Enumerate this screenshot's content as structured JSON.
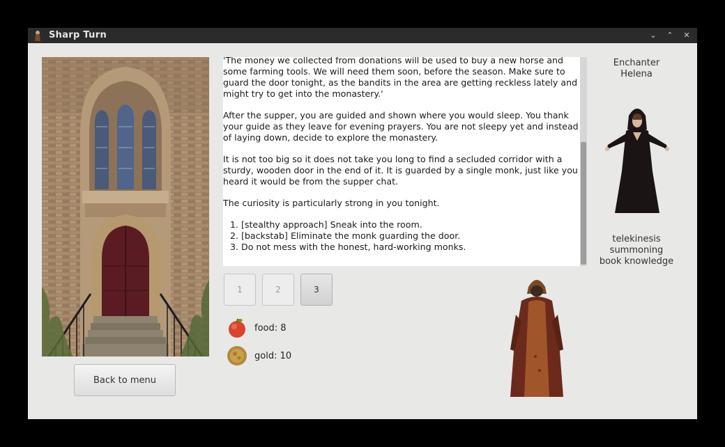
{
  "window": {
    "title": "Sharp Turn"
  },
  "story": {
    "paragraphs": [
      "'The money we collected from donations will be used to buy a new horse and some farming tools. We will need them soon, before the season. Make sure to guard the door tonight, as the bandits in the area are getting reckless lately and might try to get into the monastery.'",
      "After the supper, you are guided and shown where you would sleep. You thank your guide as they leave for evening prayers. You are not sleepy yet and instead of laying down, decide to explore the monastery.",
      "It is not too big so it does not take you long to find a secluded corridor with a sturdy, wooden door in the end of it. It is guarded by a single monk, just like you heard it would be from the supper chat.",
      "The curiosity is particularly strong in you tonight."
    ],
    "options": [
      "[stealthy approach] Sneak into the room.",
      "[backstab] Eliminate the monk guarding the door.",
      "Do not mess with the honest, hard-working monks."
    ]
  },
  "choices": [
    "1",
    "2",
    "3"
  ],
  "resources": {
    "food": "food: 8",
    "gold": "gold: 10"
  },
  "buttons": {
    "back": "Back to menu"
  },
  "character": {
    "class": "Enchanter",
    "name": "Helena",
    "skills": [
      "telekinesis",
      "summoning",
      "book knowledge"
    ]
  },
  "icons": {
    "food": "apple-icon",
    "gold": "gold-coin-icon"
  },
  "colors": {
    "titlebar": "#2b2b2b",
    "window_bg": "#e8e8e7",
    "story_bg": "#ffffff"
  }
}
